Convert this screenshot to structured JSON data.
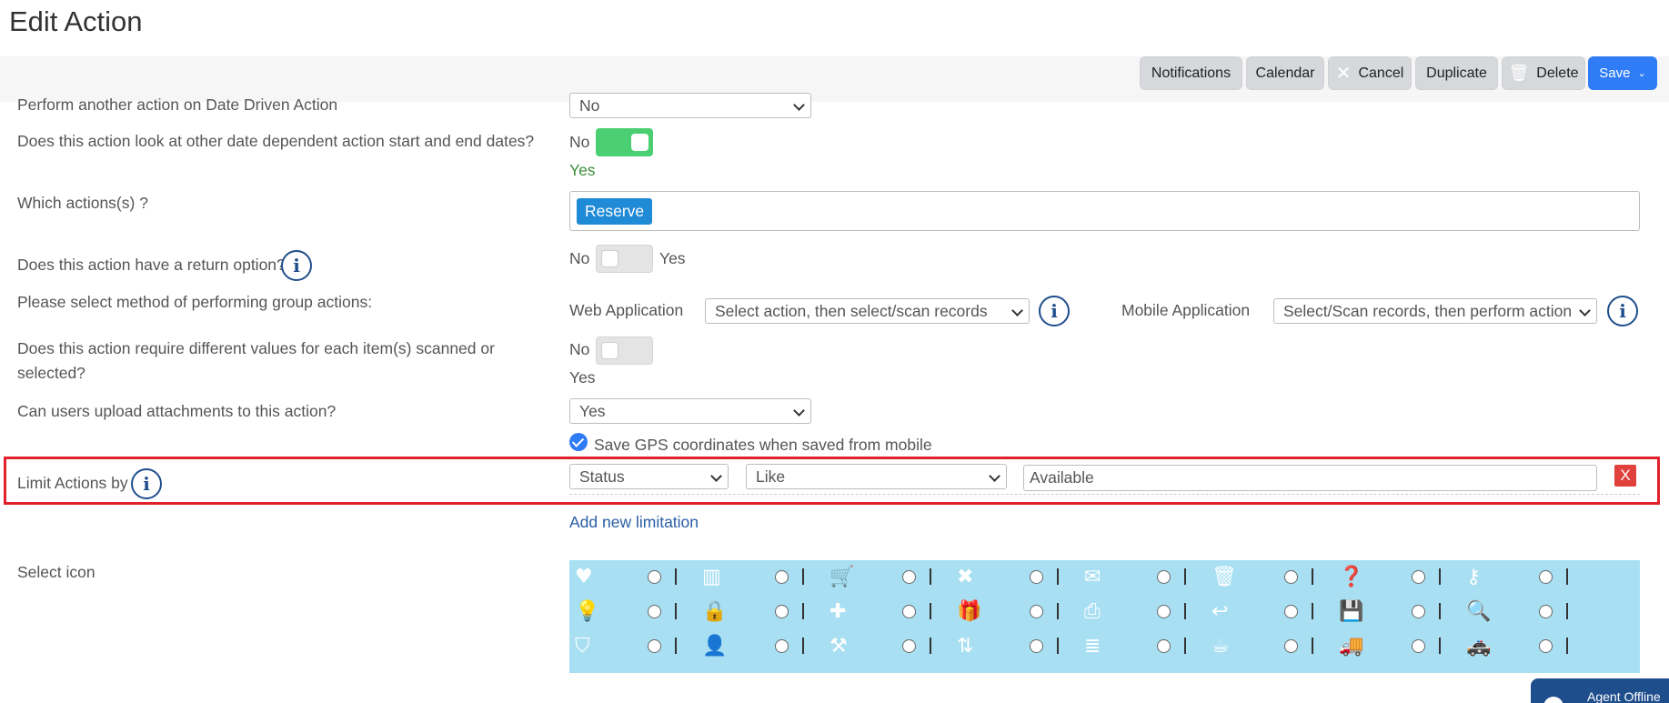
{
  "page": {
    "title": "Edit Action"
  },
  "toolbar": {
    "notifications": "Notifications",
    "calendar": "Calendar",
    "cancel": "Cancel",
    "duplicate": "Duplicate",
    "delete": "Delete",
    "save": "Save"
  },
  "form": {
    "perform_another": {
      "label": "Perform another action on Date Driven Action",
      "value": "No"
    },
    "date_dependent": {
      "label": "Does this action look at other date dependent action start and end dates?",
      "no": "No",
      "yes": "Yes",
      "state": "on"
    },
    "which_actions": {
      "label": "Which actions(s) ?",
      "chips": [
        "Reserve"
      ]
    },
    "return_option": {
      "label": "Does this action have a return option?",
      "no": "No",
      "yes": "Yes",
      "state": "off"
    },
    "group_method": {
      "label": "Please select method of performing group actions:",
      "web_label": "Web Application",
      "web_value": "Select action, then select/scan records",
      "mobile_label": "Mobile Application",
      "mobile_value": "Select/Scan records, then perform action"
    },
    "different_values": {
      "label": "Does this action require different values for each item(s) scanned or selected?",
      "no": "No",
      "yes": "Yes",
      "state": "off"
    },
    "attachments": {
      "label": "Can users upload attachments to this action?",
      "value": "Yes"
    },
    "gps": {
      "label": "Save GPS coordinates when saved from mobile",
      "checked": true
    },
    "limit": {
      "label": "Limit Actions by",
      "field": "Status",
      "operator": "Like",
      "value": "Available",
      "remove": "X",
      "add_link": "Add new limitation"
    },
    "select_icon": {
      "label": "Select icon",
      "icons": [
        "heart-icon",
        "barcode-icon",
        "cart-icon",
        "close-icon",
        "envelope-icon",
        "trash-icon",
        "question-icon",
        "key-icon",
        "lightbulb-icon",
        "lock-icon",
        "plus-icon",
        "gift-icon",
        "print-icon",
        "return-icon",
        "save-icon",
        "search-icon",
        "shield-icon",
        "user-icon",
        "tools-icon",
        "transfer-icon",
        "stack-icon",
        "cup-icon",
        "truck-icon",
        "car-icon"
      ]
    }
  },
  "agent": {
    "label": "Agent Offline"
  },
  "colors": {
    "accent": "#2f7cf6",
    "toggle_on": "#4ccf72",
    "chip": "#1f8ad6",
    "danger": "#e0413d",
    "icon_panel": "#a8dff2"
  }
}
